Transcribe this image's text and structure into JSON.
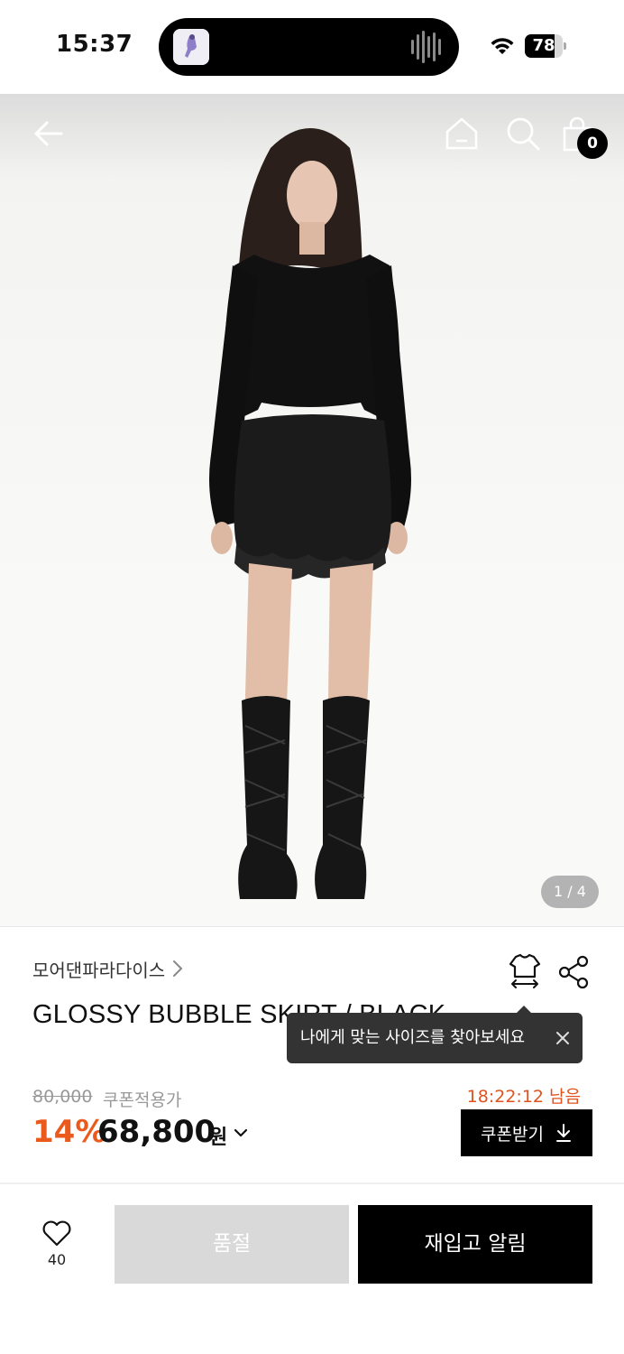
{
  "status_bar": {
    "time": "15:37",
    "battery_level": 78,
    "battery_text": "78",
    "wifi_icon": "wifi-icon",
    "island_icons": [
      "app-thumbnail-icon",
      "audio-waveform-icon"
    ]
  },
  "header": {
    "back_icon": "arrow-left-icon",
    "home_icon": "home-icon",
    "search_icon": "search-icon",
    "cart_icon": "shopping-bag-icon",
    "cart_count": "0"
  },
  "gallery": {
    "indicator": "1 / 4",
    "current": 1,
    "total": 4
  },
  "product": {
    "brand": "모어댄파라다이스",
    "title": "GLOSSY BUBBLE SKIRT / BLACK",
    "size_icon": "tshirt-size-icon",
    "share_icon": "share-icon"
  },
  "tooltip": {
    "text": "나에게 맞는 사이즈를 찾아보세요",
    "close_icon": "close-icon"
  },
  "pricing": {
    "original_price": "80,000",
    "coupon_label": "쿠폰적용가",
    "timer": "18:22:12 남음",
    "discount": "14%",
    "price": "68,800",
    "currency": "원",
    "coupon_button": "쿠폰받기",
    "accent_color": "#e95a1c"
  },
  "bottom_bar": {
    "like_count": "40",
    "soldout_label": "품절",
    "restock_label": "재입고 알림"
  }
}
